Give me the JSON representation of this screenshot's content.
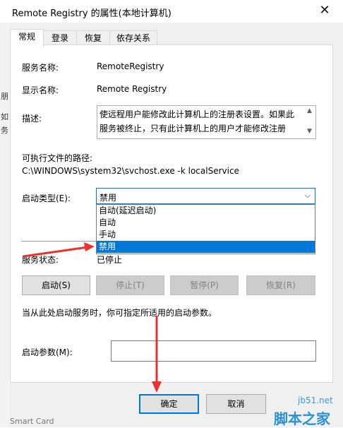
{
  "window": {
    "title": "Remote Registry 的属性(本地计算机)"
  },
  "background": {
    "chars": [
      "朋",
      "如",
      "务"
    ],
    "bottom_text": "Smart Card"
  },
  "tabs": [
    "常规",
    "登录",
    "恢复",
    "依存关系"
  ],
  "general": {
    "service_name_label": "服务名称:",
    "service_name_value": "RemoteRegistry",
    "display_name_label": "显示名称:",
    "display_name_value": "Remote Registry",
    "description_label": "描述:",
    "description_text": "使远程用户能修改此计算机上的注册表设置。如果此服务被终止，只有此计算机上的用户才能修改注册表。如",
    "exec_path_label": "可执行文件的路径:",
    "exec_path_value": "C:\\WINDOWS\\system32\\svchost.exe -k localService",
    "startup_type_label": "启动类型(E):",
    "startup_type_value": "禁用",
    "startup_options": [
      "自动(延迟启动)",
      "自动",
      "手动",
      "禁用"
    ],
    "status_label": "服务状态:",
    "status_value": "已停止",
    "buttons": {
      "start": "启动(S)",
      "stop": "停止(T)",
      "pause": "暂停(P)",
      "resume": "恢复(R)"
    },
    "hint": "当从此处启动服务时，你可指定所适用的启动参数。",
    "params_label": "启动参数(M):",
    "params_value": ""
  },
  "footer": {
    "ok": "确定",
    "cancel": "取消"
  },
  "watermark": {
    "domain": "jb51.net",
    "site": "脚本之家"
  },
  "colors": {
    "accent": "#0078d7",
    "arrow": "#e8322b"
  }
}
